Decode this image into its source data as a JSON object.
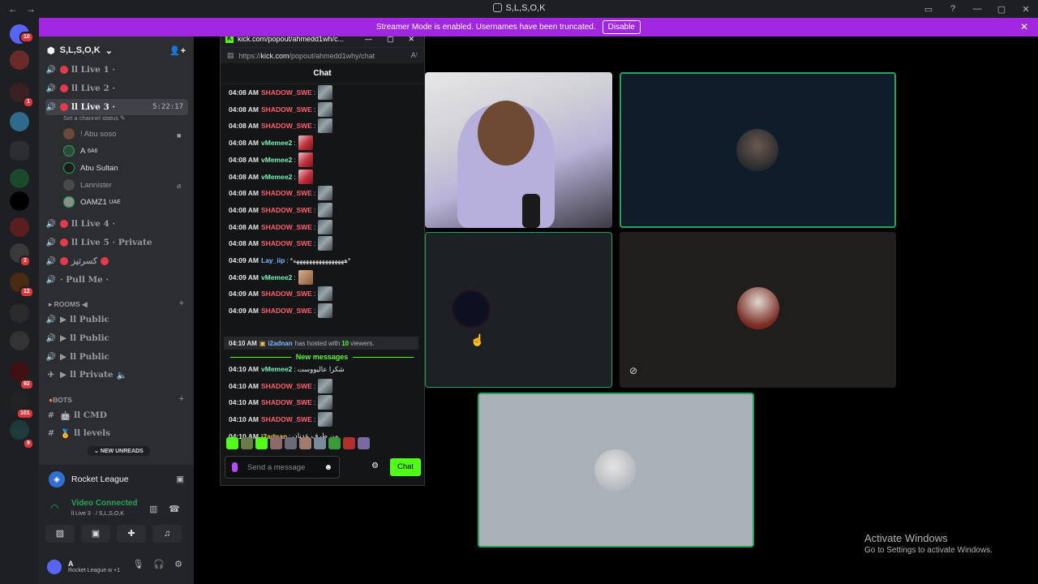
{
  "titlebar": {
    "back": "←",
    "forward": "→",
    "title": "S,L,S,O,K",
    "icons": [
      "inbox-icon",
      "help-icon",
      "minimize-icon",
      "maximize-icon",
      "close-icon"
    ]
  },
  "banner": {
    "text": "Streamer Mode is enabled. Usernames have been truncated.",
    "button": "Disable",
    "bg": "#a126df"
  },
  "rail_badges": [
    "10",
    "1",
    "2",
    "12",
    "101",
    "92",
    "9"
  ],
  "server": {
    "name": "S,L,S,O,K"
  },
  "channels": [
    {
      "label": "ll Live 1 ·",
      "state": "live"
    },
    {
      "label": "ll Live 2 ·",
      "state": "live"
    },
    {
      "label": "ll Live 3 ·",
      "state": "active",
      "timer": "5:22:17",
      "status": "Set a channel status"
    },
    {
      "label": "ll Live 4 ·",
      "state": "live"
    },
    {
      "label": "ll Live 5 · Private",
      "state": "live"
    },
    {
      "label": "كسرتيز",
      "state": "blocked"
    },
    {
      "label": "· Pull Me ·",
      "state": "plain"
    }
  ],
  "members": [
    {
      "name": "! Abu soso",
      "dim": true
    },
    {
      "name": "A",
      "tag": "6A6"
    },
    {
      "name": "Abu Sultan"
    },
    {
      "name": "Lannister",
      "dim": true
    },
    {
      "name": "OAMZ1",
      "tag": "UAE"
    }
  ],
  "rooms": {
    "title": "ROOMS",
    "items": [
      "ll Public",
      "ll Public",
      "ll Public",
      "ll Private"
    ]
  },
  "bots": {
    "title": "BOTS",
    "items": [
      "ll CMD",
      "ll levels"
    ]
  },
  "new_unreads": "NEW UNREADS",
  "activity": {
    "name": "Rocket League"
  },
  "voice": {
    "status": "Video Connected",
    "sub": "ll Live 3 · / S,L,S,O,K"
  },
  "user": {
    "name": "A",
    "status": "Rocket League w +1"
  },
  "popout": {
    "title": "kick.com/popout/ahmedd1wh/c...",
    "url_prefix": "https://",
    "url_host": "kick.com",
    "url_path": "/popout/ahmedd1why/chat",
    "header": "Chat",
    "messages": [
      {
        "time": "04:08 AM",
        "user": "SHADOW_SWE",
        "cls": "shadow",
        "emote": "em-shadow"
      },
      {
        "time": "04:08 AM",
        "user": "SHADOW_SWE",
        "cls": "shadow",
        "emote": "em-shadow"
      },
      {
        "time": "04:08 AM",
        "user": "SHADOW_SWE",
        "cls": "shadow",
        "emote": "em-shadow"
      },
      {
        "time": "04:08 AM",
        "user": "vMemee2",
        "cls": "vm",
        "emote": "em-vm"
      },
      {
        "time": "04:08 AM",
        "user": "vMemee2",
        "cls": "vm",
        "emote": "em-vm"
      },
      {
        "time": "04:08 AM",
        "user": "vMemee2",
        "cls": "vm",
        "emote": "em-vm"
      },
      {
        "time": "04:08 AM",
        "user": "SHADOW_SWE",
        "cls": "shadow",
        "emote": "em-shadow"
      },
      {
        "time": "04:08 AM",
        "user": "SHADOW_SWE",
        "cls": "shadow",
        "emote": "em-shadow"
      },
      {
        "time": "04:08 AM",
        "user": "SHADOW_SWE",
        "cls": "shadow",
        "emote": "em-shadow"
      },
      {
        "time": "04:08 AM",
        "user": "SHADOW_SWE",
        "cls": "shadow",
        "emote": "em-shadow"
      },
      {
        "time": "04:09 AM",
        "user": "Lay_iip",
        "cls": "lay",
        "text": "*ههههههههههههههههه*"
      },
      {
        "time": "04:09 AM",
        "user": "vMemee2",
        "cls": "vm",
        "emote": "em-vm2"
      },
      {
        "time": "04:09 AM",
        "user": "SHADOW_SWE",
        "cls": "shadow",
        "emote": "em-shadow"
      },
      {
        "time": "04:09 AM",
        "user": "SHADOW_SWE",
        "cls": "shadow",
        "emote": "em-shadow"
      }
    ],
    "hosted": {
      "time": "04:10 AM",
      "user": "i2adnan",
      "middle": "has hosted with",
      "count": "10",
      "end": "viewers."
    },
    "new_messages": "New messages",
    "new": [
      {
        "time": "04:10 AM",
        "user": "vMemee2",
        "cls": "vm",
        "text": "شكرا عاليووست"
      },
      {
        "time": "04:10 AM",
        "user": "SHADOW_SWE",
        "cls": "shadow",
        "emote": "em-shadow"
      },
      {
        "time": "04:10 AM",
        "user": "SHADOW_SWE",
        "cls": "shadow",
        "emote": "em-shadow"
      },
      {
        "time": "04:10 AM",
        "user": "SHADOW_SWE",
        "cls": "shadow",
        "emote": "em-shadow"
      },
      {
        "time": "04:10 AM",
        "user": "i2adnan",
        "cls": "i2",
        "text": "من طرف عدنان"
      }
    ],
    "placeholder": "Send a message",
    "chat_button": "Chat",
    "accent": "#53fc18"
  },
  "watermark": {
    "title": "Activate Windows",
    "sub": "Go to Settings to activate Windows."
  }
}
